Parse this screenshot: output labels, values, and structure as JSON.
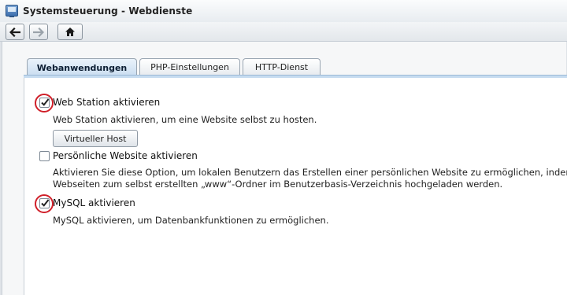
{
  "window": {
    "title": "Systemsteuerung - Webdienste"
  },
  "toolbar": {
    "back_icon": "arrow-left",
    "forward_icon": "arrow-right",
    "home_icon": "house"
  },
  "tabs": [
    {
      "label": "Webanwendungen",
      "active": true
    },
    {
      "label": "PHP-Einstellungen",
      "active": false
    },
    {
      "label": "HTTP-Dienst",
      "active": false
    }
  ],
  "options": {
    "web_station": {
      "label": "Web Station aktivieren",
      "checked": true,
      "description": "Web Station aktivieren, um eine Website selbst zu hosten.",
      "button_label": "Virtueller Host"
    },
    "personal_website": {
      "label": "Persönliche Website aktivieren",
      "checked": false,
      "description_line1": "Aktivieren Sie diese Option, um lokalen Benutzern das Erstellen einer persönlichen Website zu ermöglichen, indem",
      "description_line2": "Webseiten zum selbst erstellten „www“-Ordner im Benutzerbasis-Verzeichnis hochgeladen werden."
    },
    "mysql": {
      "label": "MySQL aktivieren",
      "checked": true,
      "description": "MySQL aktivieren, um Datenbankfunktionen zu ermöglichen."
    }
  },
  "colors": {
    "highlight_ring": "#d0202a",
    "active_tab": "#c9ddf0"
  }
}
